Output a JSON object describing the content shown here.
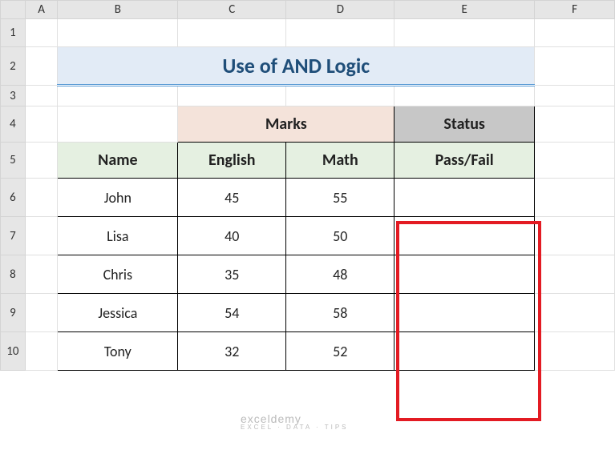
{
  "columns": [
    "A",
    "B",
    "C",
    "D",
    "E",
    "F"
  ],
  "rows": [
    "1",
    "2",
    "3",
    "4",
    "5",
    "6",
    "7",
    "8",
    "9",
    "10"
  ],
  "title": "Use of AND Logic",
  "headers": {
    "marks": "Marks",
    "status": "Status",
    "name": "Name",
    "english": "English",
    "math": "Math",
    "passfail": "Pass/Fail"
  },
  "data": [
    {
      "name": "John",
      "english": "45",
      "math": "55",
      "status": ""
    },
    {
      "name": "Lisa",
      "english": "40",
      "math": "50",
      "status": ""
    },
    {
      "name": "Chris",
      "english": "35",
      "math": "48",
      "status": ""
    },
    {
      "name": "Jessica",
      "english": "54",
      "math": "58",
      "status": ""
    },
    {
      "name": "Tony",
      "english": "32",
      "math": "52",
      "status": ""
    }
  ],
  "watermark": {
    "main": "exceldemy",
    "sub": "EXCEL · DATA · TIPS"
  },
  "chart_data": {
    "type": "table",
    "title": "Use of AND Logic",
    "columns": [
      "Name",
      "English",
      "Math",
      "Pass/Fail"
    ],
    "rows": [
      [
        "John",
        45,
        55,
        ""
      ],
      [
        "Lisa",
        40,
        50,
        ""
      ],
      [
        "Chris",
        35,
        48,
        ""
      ],
      [
        "Jessica",
        54,
        58,
        ""
      ],
      [
        "Tony",
        32,
        52,
        ""
      ]
    ]
  }
}
